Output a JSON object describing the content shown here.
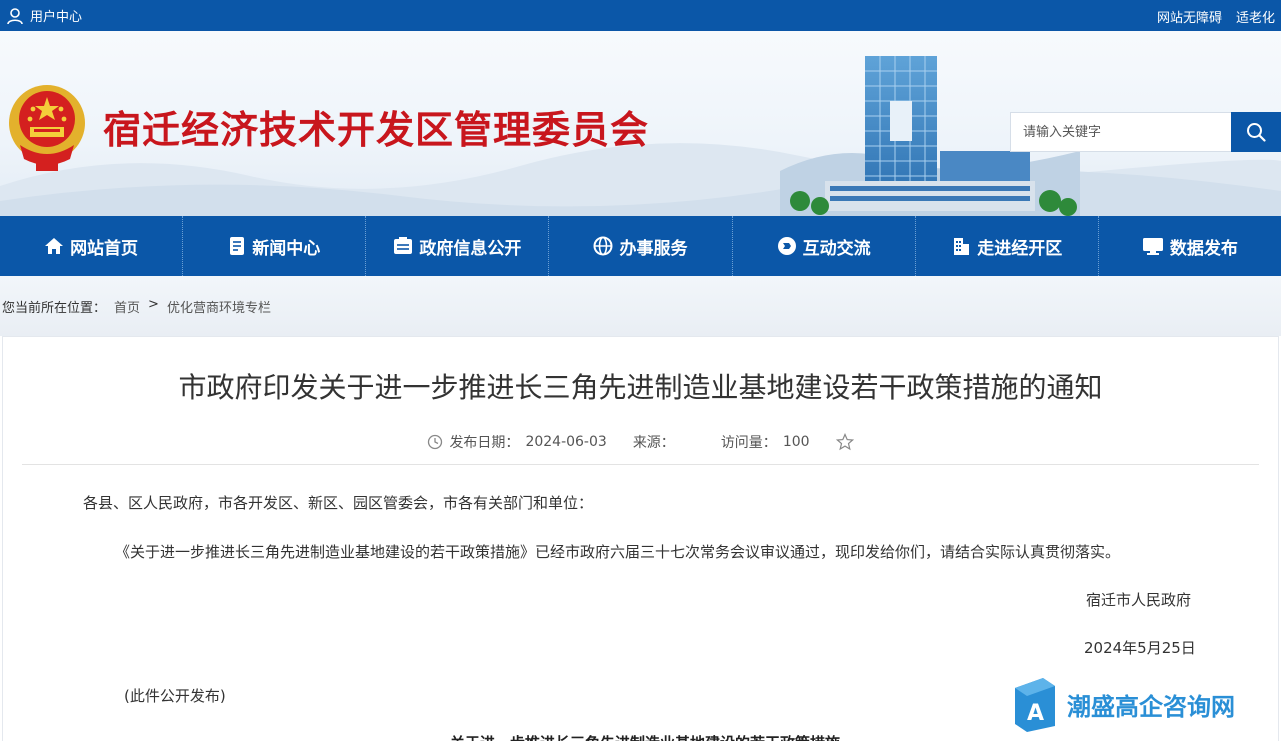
{
  "topbar": {
    "user_center": "用户中心",
    "accessibility": "网站无障碍",
    "elderly_mode": "适老化"
  },
  "header": {
    "site_title": "宿迁经济技术开发区管理委员会",
    "search_placeholder": "请输入关键字"
  },
  "nav": {
    "items": [
      {
        "label": "网站首页",
        "icon": "home-icon"
      },
      {
        "label": "新闻中心",
        "icon": "news-icon"
      },
      {
        "label": "政府信息公开",
        "icon": "info-icon"
      },
      {
        "label": "办事服务",
        "icon": "globe-icon"
      },
      {
        "label": "互动交流",
        "icon": "chat-icon"
      },
      {
        "label": "走进经开区",
        "icon": "building-icon"
      },
      {
        "label": "数据发布",
        "icon": "monitor-icon"
      }
    ]
  },
  "breadcrumb": {
    "prefix": "您当前所在位置：",
    "home": "首页",
    "separator": ">",
    "current": "优化营商环境专栏"
  },
  "article": {
    "title": "市政府印发关于进一步推进长三角先进制造业基地建设若干政策措施的通知",
    "publish_label": "发布日期：",
    "publish_date": "2024-06-03",
    "source_label": "来源：",
    "visits_label": "访问量：",
    "visits": "100",
    "salutation": "各县、区人民政府，市各开发区、新区、园区管委会，市各有关部门和单位：",
    "body": "《关于进一步推进长三角先进制造业基地建设的若干政策措施》已经市政府六届三十七次常务会议审议通过，现印发给你们，请结合实际认真贯彻落实。",
    "signer": "宿迁市人民政府",
    "sign_date": "2024年5月25日",
    "disclosure": "(此件公开发布)",
    "attachment_title": "关于进一步推进长三角先进制造业基地建设的若干政策措施"
  },
  "watermark": {
    "text": "潮盛高企咨询网"
  },
  "colors": {
    "primary": "#0b57a8",
    "title_red": "#c8161d",
    "watermark_blue": "#2a8fd6"
  }
}
